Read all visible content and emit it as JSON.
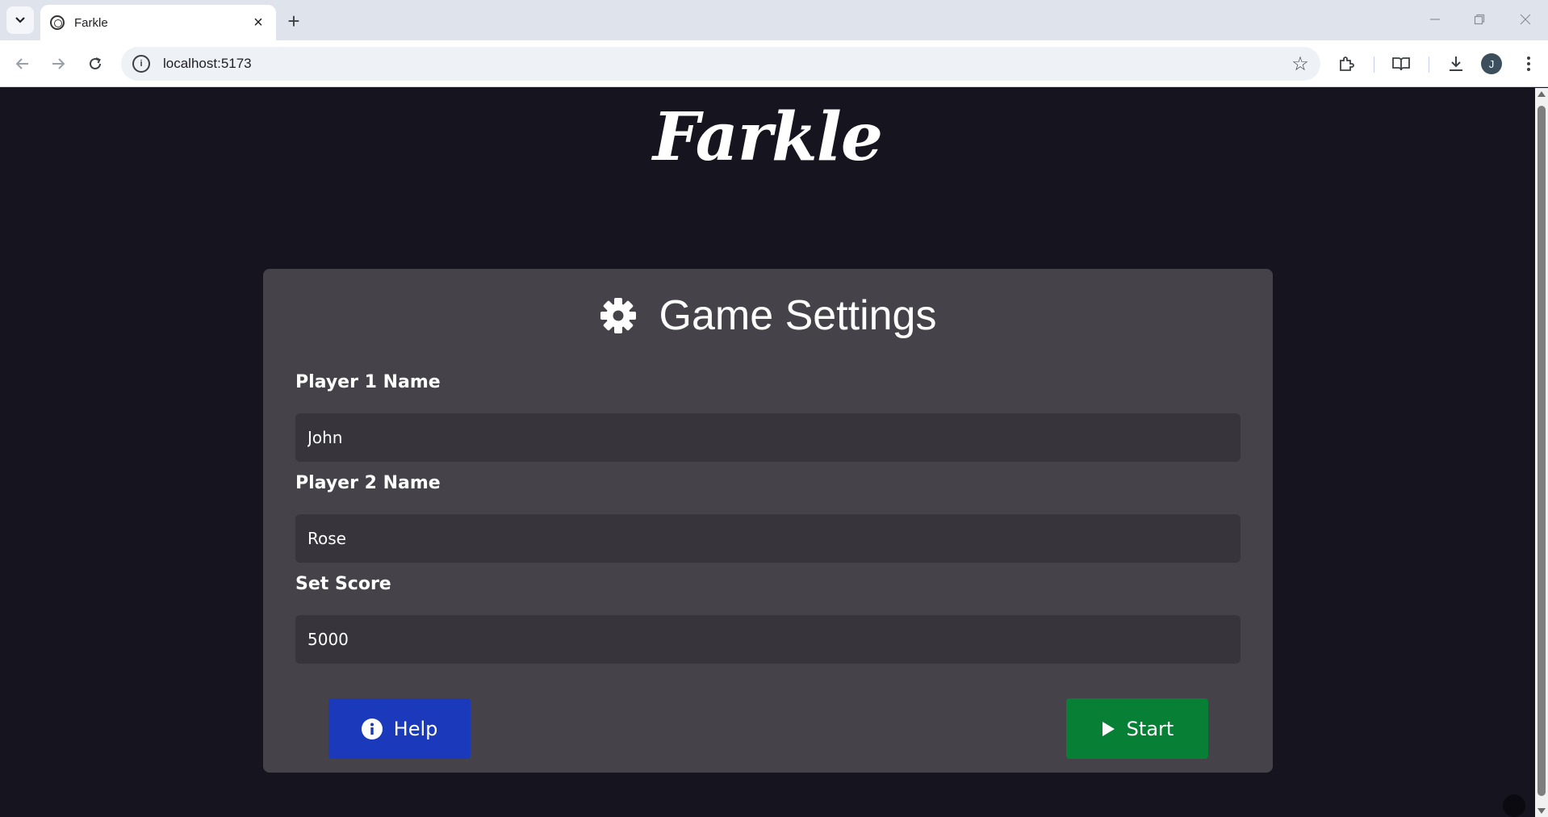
{
  "browser": {
    "tab": {
      "title": "Farkle",
      "close_glyph": "×"
    },
    "new_tab_glyph": "+",
    "url": "localhost:5173",
    "profile_initial": "J",
    "icons": [
      "tab-search-icon",
      "back-icon",
      "forward-icon",
      "reload-icon",
      "site-info-icon",
      "bookmark-star-icon",
      "extensions-icon",
      "reading-mode-icon",
      "download-icon",
      "menu-icon",
      "minimize-icon",
      "restore-icon",
      "close-window-icon"
    ]
  },
  "app": {
    "logo": "Farkle",
    "settings": {
      "title": "Game Settings",
      "icon": "gear-icon",
      "fields": [
        {
          "label": "Player 1 Name",
          "value": "John"
        },
        {
          "label": "Player 2 Name",
          "value": "Rose"
        },
        {
          "label": "Set Score",
          "value": "5000"
        }
      ],
      "help_label": "Help",
      "start_label": "Start"
    }
  },
  "colors": {
    "background": "#16151f",
    "card": "#454349",
    "input": "#37353b",
    "help_button": "#1a3abb",
    "start_button": "#077f34"
  }
}
